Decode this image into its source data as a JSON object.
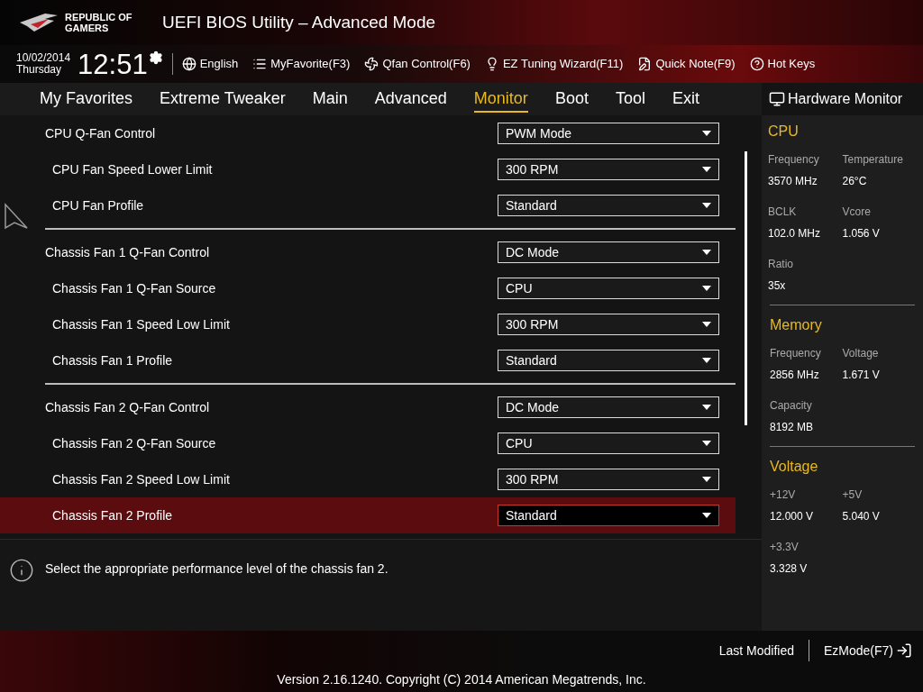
{
  "header": {
    "logo_text": "REPUBLIC OF GAMERS",
    "title": "UEFI BIOS Utility – Advanced Mode"
  },
  "toolbar": {
    "date": "10/02/2014",
    "day": "Thursday",
    "time": "12:51",
    "items": [
      {
        "label": "English",
        "kind": "language"
      },
      {
        "label": "MyFavorite(F3)",
        "kind": "favorite"
      },
      {
        "label": "Qfan Control(F6)",
        "kind": "fan"
      },
      {
        "label": "EZ Tuning Wizard(F11)",
        "kind": "wizard"
      },
      {
        "label": "Quick Note(F9)",
        "kind": "note"
      },
      {
        "label": "Hot Keys",
        "kind": "help"
      }
    ]
  },
  "tabs": [
    {
      "label": "My Favorites",
      "selected": false
    },
    {
      "label": "Extreme Tweaker",
      "selected": false
    },
    {
      "label": "Main",
      "selected": false
    },
    {
      "label": "Advanced",
      "selected": false
    },
    {
      "label": "Monitor",
      "selected": true
    },
    {
      "label": "Boot",
      "selected": false
    },
    {
      "label": "Tool",
      "selected": false
    },
    {
      "label": "Exit",
      "selected": false
    }
  ],
  "settings": [
    {
      "groups": [
        {
          "label": "CPU Q-Fan Control",
          "value": "PWM Mode",
          "kind": "group",
          "selected": false
        },
        {
          "label": "CPU Fan Speed Lower Limit",
          "value": "300 RPM",
          "kind": "sub",
          "selected": false
        },
        {
          "label": "CPU Fan Profile",
          "value": "Standard",
          "kind": "sub",
          "selected": false
        }
      ]
    },
    {
      "groups": [
        {
          "label": "Chassis Fan 1 Q-Fan Control",
          "value": "DC Mode",
          "kind": "group",
          "selected": false
        },
        {
          "label": "Chassis Fan 1 Q-Fan Source",
          "value": "CPU",
          "kind": "sub",
          "selected": false
        },
        {
          "label": "Chassis Fan 1 Speed Low Limit",
          "value": "300 RPM",
          "kind": "sub",
          "selected": false
        },
        {
          "label": "Chassis Fan 1 Profile",
          "value": "Standard",
          "kind": "sub",
          "selected": false
        }
      ]
    },
    {
      "groups": [
        {
          "label": "Chassis Fan 2 Q-Fan Control",
          "value": "DC Mode",
          "kind": "group",
          "selected": false
        },
        {
          "label": "Chassis Fan 2 Q-Fan Source",
          "value": "CPU",
          "kind": "sub",
          "selected": false
        },
        {
          "label": "Chassis Fan 2 Speed Low Limit",
          "value": "300 RPM",
          "kind": "sub",
          "selected": false
        },
        {
          "label": "Chassis Fan 2 Profile",
          "value": "Standard",
          "kind": "sub",
          "selected": true
        }
      ]
    }
  ],
  "help_text": "Select the appropriate performance level of the chassis fan 2.",
  "hardware_monitor": {
    "title": "Hardware Monitor",
    "sections": [
      {
        "title": "CPU",
        "items": [
          {
            "label": "Frequency",
            "value": "3570 MHz"
          },
          {
            "label": "Temperature",
            "value": "26°C"
          },
          {
            "label": "BCLK",
            "value": "102.0 MHz"
          },
          {
            "label": "Vcore",
            "value": "1.056 V"
          },
          {
            "label": "Ratio",
            "value": "35x"
          }
        ]
      },
      {
        "title": "Memory",
        "items": [
          {
            "label": "Frequency",
            "value": "2856 MHz"
          },
          {
            "label": "Voltage",
            "value": "1.671 V"
          },
          {
            "label": "Capacity",
            "value": "8192 MB"
          }
        ]
      },
      {
        "title": "Voltage",
        "items": [
          {
            "label": "+12V",
            "value": "12.000 V"
          },
          {
            "label": "+5V",
            "value": "5.040 V"
          },
          {
            "label": "+3.3V",
            "value": "3.328 V"
          }
        ]
      }
    ]
  },
  "footer": {
    "last_modified": "Last Modified",
    "ez_mode": "EzMode(F7)",
    "version": "Version 2.16.1240. Copyright (C) 2014 American Megatrends, Inc."
  }
}
